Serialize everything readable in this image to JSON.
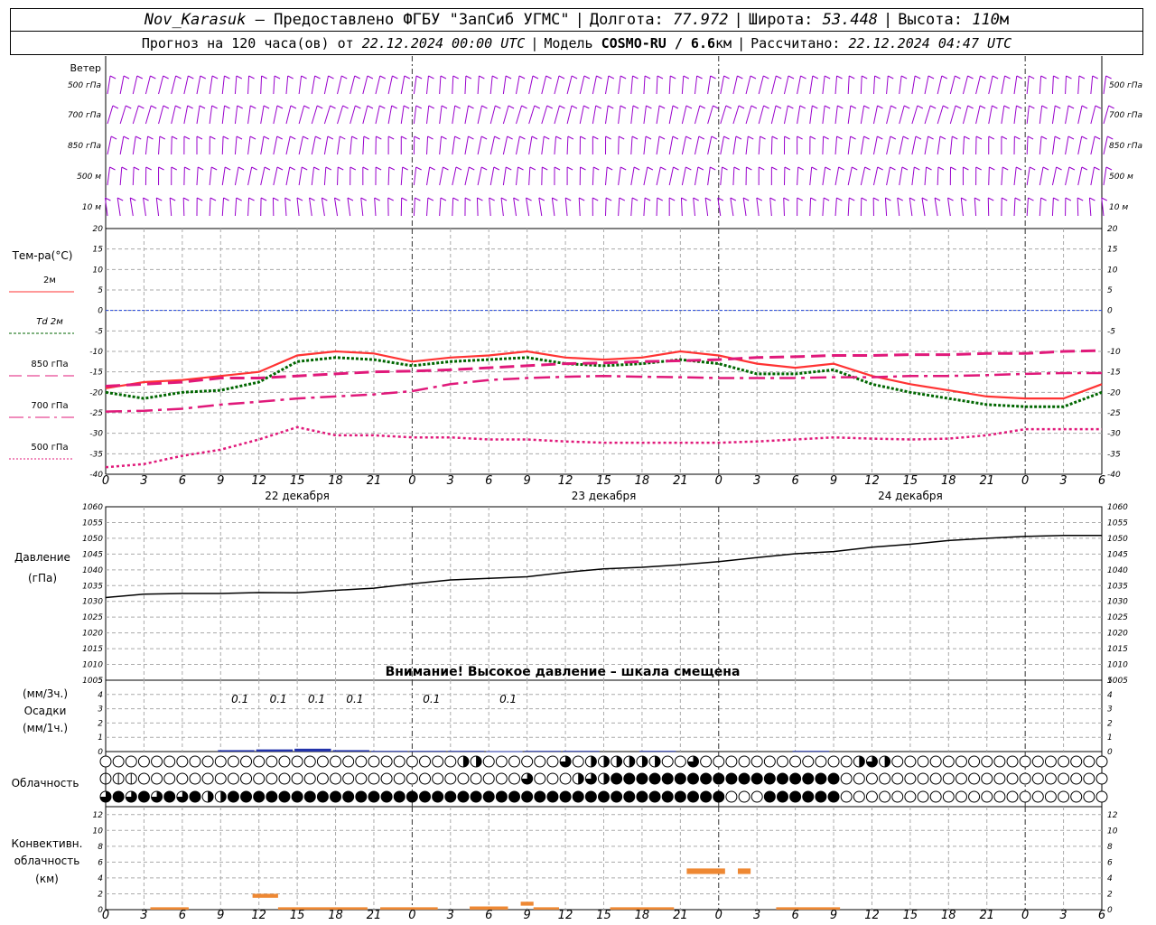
{
  "header": {
    "station": "Nov_Karasuk",
    "provider": "– Предоставлено ФГБУ \"ЗапСиб УГМС\"",
    "lon_label": "Долгота:",
    "lon_value": "77.972",
    "lat_label": "Широта:",
    "lat_value": "53.448",
    "alt_label": "Высота:",
    "alt_value": "110",
    "alt_unit": "м",
    "forecast_label": "Прогноз на 120 часа(ов) от",
    "forecast_start": "22.12.2024 00:00 UTC",
    "model_label": "Модель",
    "model_name": "COSMO-RU / 6.6",
    "model_unit": "км",
    "calc_label": "Рассчитано:",
    "calc_time": "22.12.2024 04:47 UTC"
  },
  "wind": {
    "title": "Ветер",
    "levels": [
      "500 гПа",
      "700 гПа",
      "850 гПа",
      "500 м",
      "10 м"
    ],
    "color": "#9900cc"
  },
  "temperature": {
    "title": "Тем-ра(°C)",
    "legend": [
      {
        "label": "2м",
        "color": "#ff3333",
        "style": "solid"
      },
      {
        "label": "Td  2м",
        "color": "#006600",
        "style": "dotted"
      },
      {
        "label": "850 гПа",
        "color": "#e0197a",
        "style": "dash"
      },
      {
        "label": "700 гПа",
        "color": "#e0197a",
        "style": "dashdot"
      },
      {
        "label": "500 гПа",
        "color": "#e0197a",
        "style": "dot"
      }
    ]
  },
  "time_axis": {
    "hour_labels": [
      "0",
      "3",
      "6",
      "9",
      "12",
      "15",
      "18",
      "21",
      "0",
      "3",
      "6",
      "9",
      "12",
      "15",
      "18",
      "21",
      "0",
      "3",
      "6",
      "9",
      "12",
      "15",
      "18",
      "21",
      "0",
      "3",
      "6"
    ],
    "dates": [
      "22 декабря",
      "23 декабря",
      "24 декабря"
    ]
  },
  "pressure": {
    "title_line1": "Давление",
    "title_line2": "(гПа)",
    "warning": "Внимание! Высокое давление – шкала смещена"
  },
  "precip": {
    "title_unit3": "(мм/3ч.)",
    "title": "Осадки",
    "title_unit1": "(мм/1ч.)",
    "labels": [
      {
        "hour": 12,
        "text": "0.1"
      },
      {
        "hour": 15,
        "text": "0.1"
      },
      {
        "hour": 18,
        "text": "0.1"
      },
      {
        "hour": 21,
        "text": "0.1"
      },
      {
        "hour": 27,
        "text": "0.1"
      },
      {
        "hour": 33,
        "text": "0.1"
      }
    ]
  },
  "cloud": {
    "title": "Облачность"
  },
  "convective": {
    "title_line1": "Конвективн.",
    "title_line2": "облачность",
    "title_line3": "(км)"
  },
  "chart_data": [
    {
      "type": "line",
      "title": "",
      "ylabel": "Тем-ра(°C)",
      "ylim": [
        -40,
        20
      ],
      "yticks": [
        -40,
        -35,
        -30,
        -25,
        -20,
        -15,
        -10,
        -5,
        0,
        5,
        10,
        15,
        20
      ],
      "x_hours": [
        0,
        3,
        6,
        9,
        12,
        15,
        18,
        21,
        24,
        27,
        30,
        33,
        36,
        39,
        42,
        45,
        48,
        51,
        54,
        57,
        60,
        63,
        66,
        69,
        72,
        75,
        78
      ],
      "series": [
        {
          "name": "2м",
          "values": [
            -19,
            -17.5,
            -17,
            -16,
            -15,
            -11,
            -10,
            -10.5,
            -12.5,
            -11.5,
            -11,
            -10,
            -11.5,
            -12,
            -11.5,
            -10,
            -11,
            -13,
            -14,
            -13,
            -16,
            -18,
            -19.5,
            -21,
            -21.5,
            -21.5,
            -18
          ]
        },
        {
          "name": "Td 2м",
          "values": [
            -20,
            -21.5,
            -20,
            -19.5,
            -17.5,
            -12.5,
            -11.5,
            -12,
            -13.5,
            -12.5,
            -12,
            -11.5,
            -13,
            -13.5,
            -13,
            -12,
            -13,
            -15.5,
            -15.5,
            -14.5,
            -18,
            -20,
            -21.5,
            -23,
            -23.5,
            -23.5,
            -20
          ]
        },
        {
          "name": "850 гПа",
          "values": [
            -18.5,
            -18,
            -17.5,
            -16.5,
            -16.5,
            -16,
            -15.5,
            -15,
            -14.8,
            -14.5,
            -14,
            -13.5,
            -13,
            -12.8,
            -12.5,
            -12.3,
            -12,
            -11.5,
            -11.3,
            -11,
            -11,
            -10.8,
            -10.8,
            -10.5,
            -10.5,
            -10,
            -9.8
          ]
        },
        {
          "name": "700 гПа",
          "values": [
            -24.7,
            -24.5,
            -24,
            -23,
            -22.3,
            -21.5,
            -21,
            -20.5,
            -19.7,
            -18,
            -17,
            -16.5,
            -16.2,
            -16,
            -16.2,
            -16.3,
            -16.5,
            -16.5,
            -16.5,
            -16.3,
            -16.3,
            -16,
            -16,
            -15.8,
            -15.5,
            -15.3,
            -15.3
          ]
        },
        {
          "name": "500 гПа",
          "values": [
            -38.3,
            -37.5,
            -35.5,
            -34,
            -31.5,
            -28.5,
            -30.5,
            -30.5,
            -31,
            -31,
            -31.5,
            -31.5,
            -32,
            -32.3,
            -32.3,
            -32.3,
            -32.3,
            -32,
            -31.5,
            -31,
            -31.3,
            -31.5,
            -31.3,
            -30.5,
            -29,
            -29,
            -29
          ]
        }
      ]
    },
    {
      "type": "line",
      "title": "",
      "ylabel": "Давление (гПа)",
      "ylim": [
        1005,
        1060
      ],
      "yticks": [
        1005,
        1010,
        1015,
        1020,
        1025,
        1030,
        1035,
        1040,
        1045,
        1050,
        1055,
        1060
      ],
      "x_hours": [
        0,
        3,
        6,
        9,
        12,
        15,
        18,
        21,
        24,
        27,
        30,
        33,
        36,
        39,
        42,
        45,
        48,
        51,
        54,
        57,
        60,
        63,
        66,
        69,
        72,
        75,
        78
      ],
      "series": [
        {
          "name": "",
          "values": [
            1031.2,
            1032.3,
            1032.5,
            1032.5,
            1032.8,
            1032.7,
            1033.5,
            1034.2,
            1035.6,
            1036.8,
            1037.3,
            1037.8,
            1039.2,
            1040.3,
            1040.8,
            1041.6,
            1042.6,
            1043.9,
            1045.1,
            1045.8,
            1047.2,
            1048.1,
            1049.3,
            1050,
            1050.6,
            1050.9,
            1050.9
          ]
        }
      ]
    },
    {
      "type": "bar",
      "title": "",
      "ylabel": "Осадки (мм/3ч.)",
      "ylim": [
        0,
        5
      ],
      "x_hours": [
        9,
        12,
        15,
        18,
        21,
        24,
        27,
        30,
        33,
        36,
        42,
        54
      ],
      "values": [
        0.1,
        0.15,
        0.2,
        0.1,
        0.05,
        0.05,
        0.05,
        0.03,
        0.05,
        0.05,
        0.05,
        0.05
      ]
    },
    {
      "type": "bar",
      "title": "",
      "ylabel": "Конвективн. облачность (км)",
      "ylim": [
        0,
        13
      ],
      "segments": [
        {
          "from": 3.5,
          "to": 6.5,
          "base": 0,
          "top": 0.3
        },
        {
          "from": 11.5,
          "to": 13.5,
          "base": 1.5,
          "top": 2
        },
        {
          "from": 13.5,
          "to": 20.5,
          "base": 0,
          "top": 0.3
        },
        {
          "from": 21.5,
          "to": 26,
          "base": 0,
          "top": 0.3
        },
        {
          "from": 28.5,
          "to": 31.5,
          "base": 0,
          "top": 0.4
        },
        {
          "from": 32.5,
          "to": 33.5,
          "base": 0.5,
          "top": 1
        },
        {
          "from": 33.5,
          "to": 35.5,
          "base": 0,
          "top": 0.3
        },
        {
          "from": 39.5,
          "to": 44.5,
          "base": 0,
          "top": 0.3
        },
        {
          "from": 45.5,
          "to": 48.5,
          "base": 4.5,
          "top": 5.2
        },
        {
          "from": 49.5,
          "to": 50.5,
          "base": 4.5,
          "top": 5.2
        },
        {
          "from": 52.5,
          "to": 57.5,
          "base": 0,
          "top": 0.3
        }
      ]
    }
  ]
}
